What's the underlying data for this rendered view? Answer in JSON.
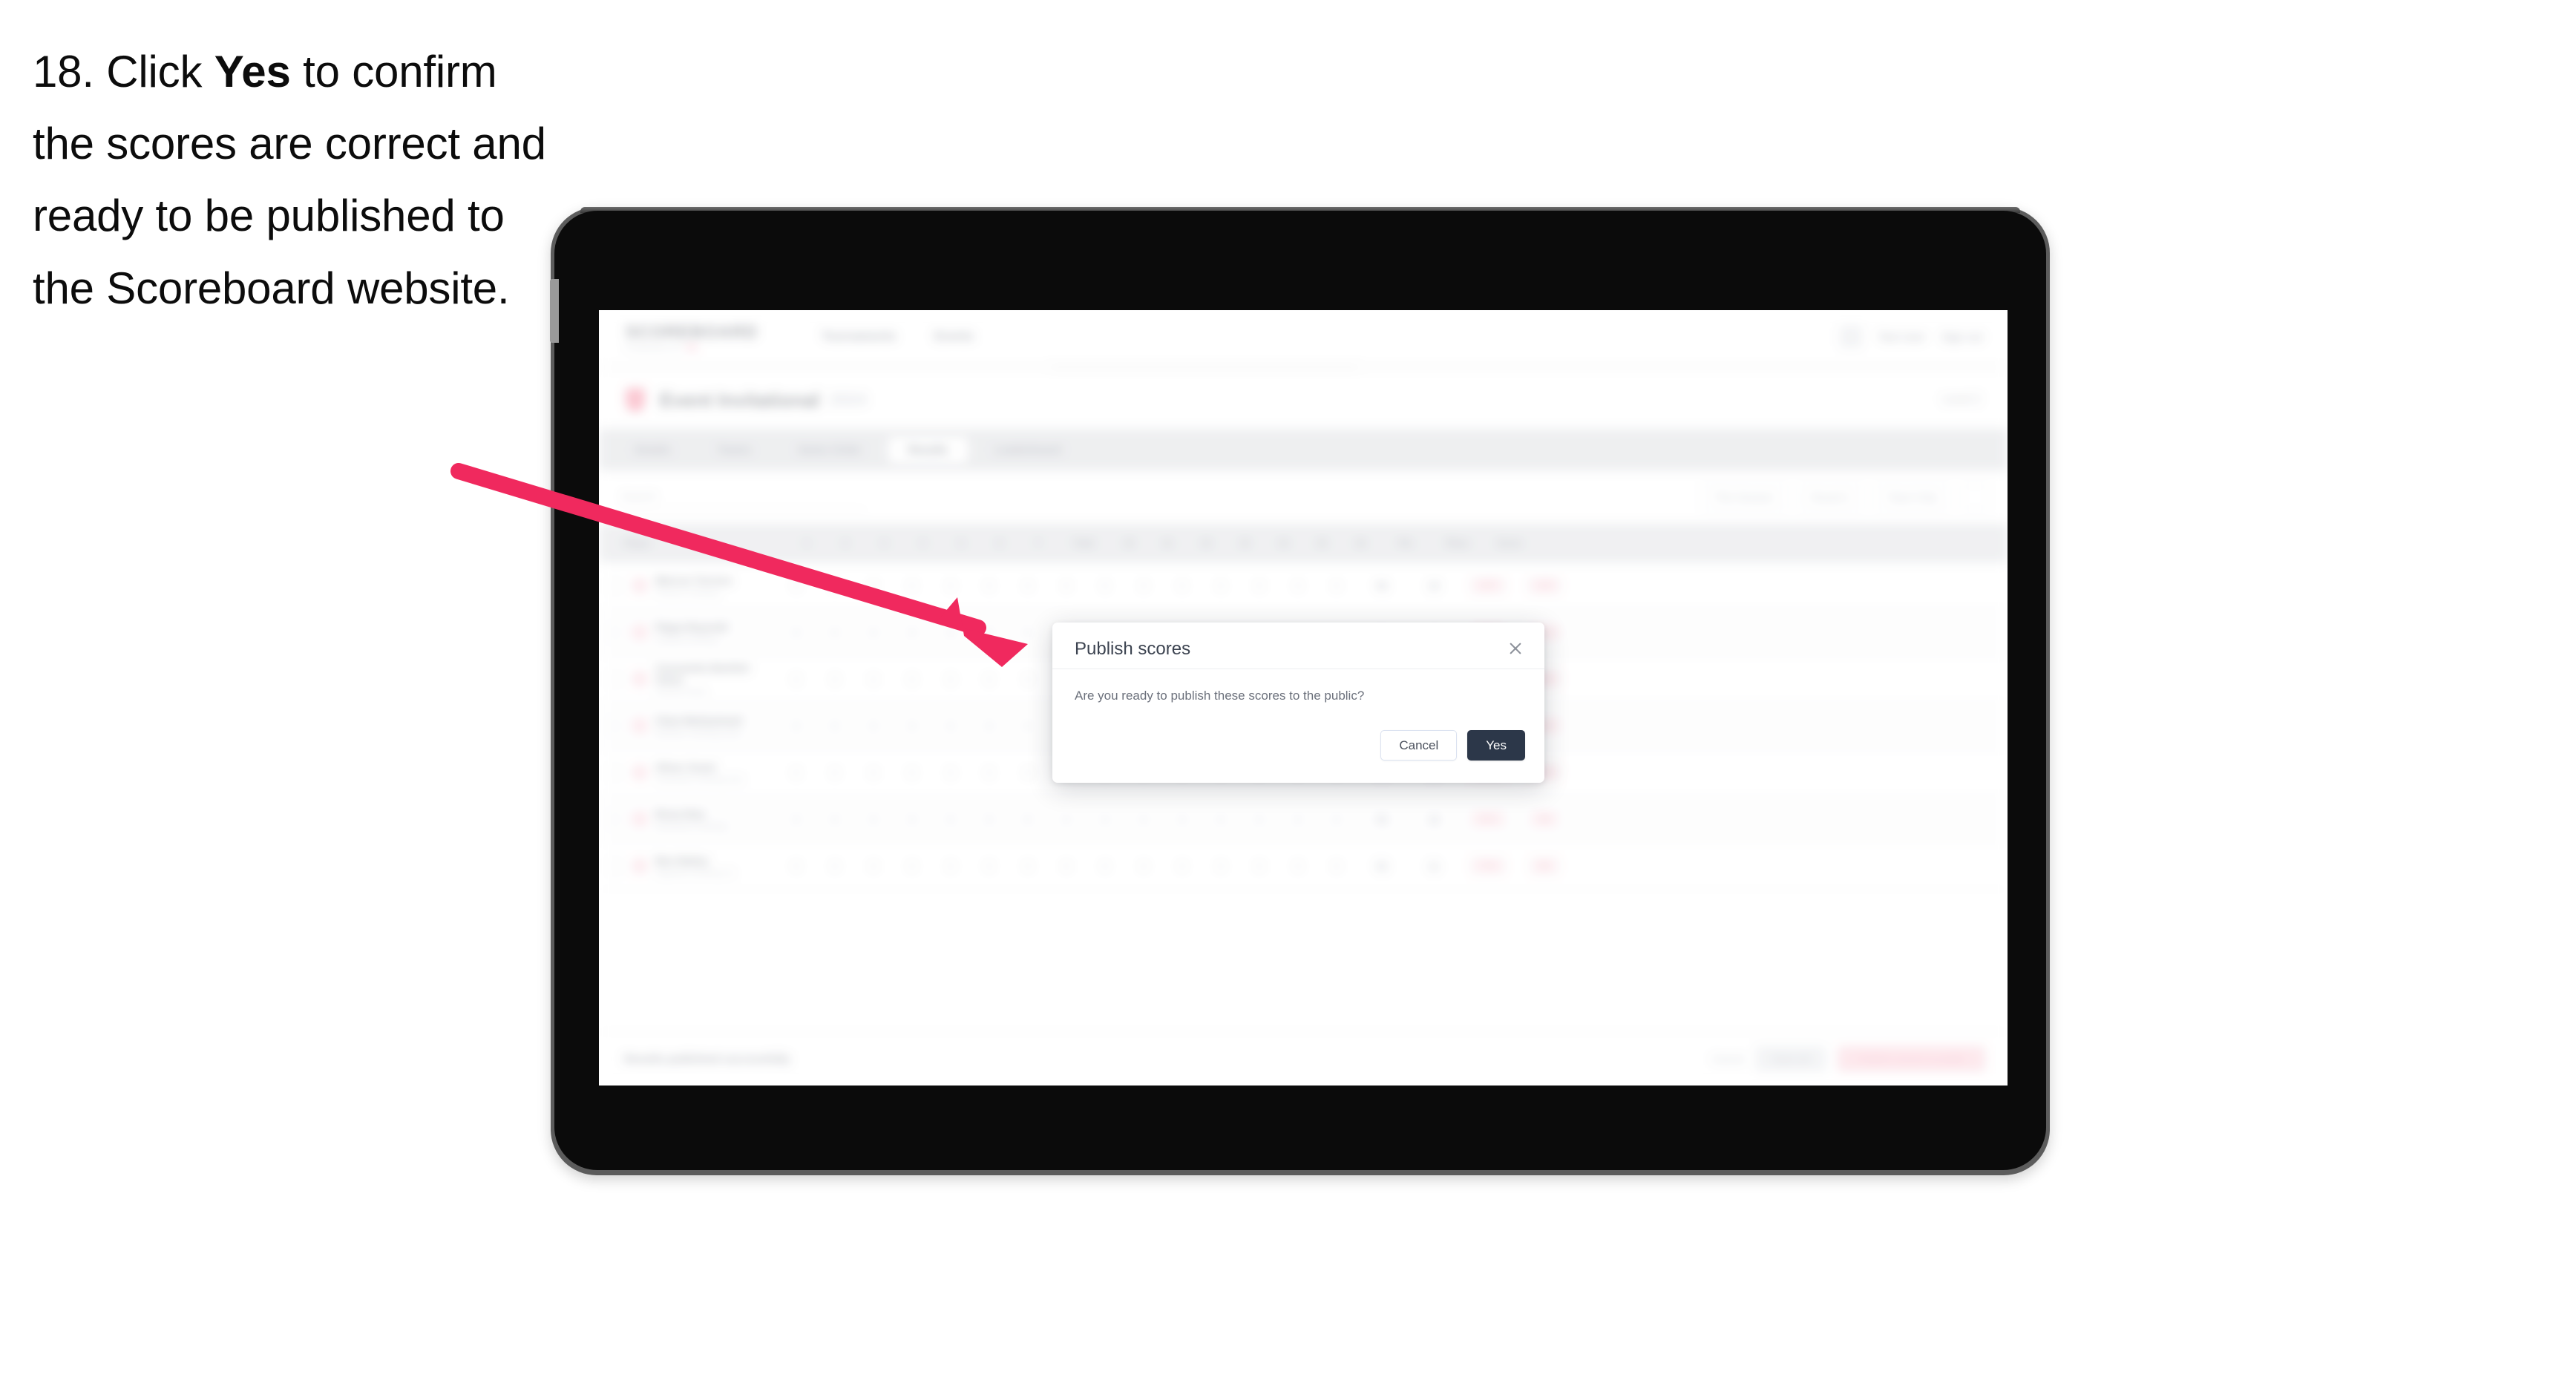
{
  "instruction": {
    "number": "18.",
    "text_before": "Click",
    "emphasis": "Yes",
    "text_after": "to confirm the scores are correct and ready to be published to the Scoreboard website."
  },
  "annotation": {
    "arrow_color": "#f0295e",
    "arrow_name": "pointer-arrow"
  },
  "device": {
    "kind": "tablet",
    "bezel_color": "#0b0b0b",
    "frame_color": "#5c5c5c"
  },
  "app": {
    "logo": {
      "main": "SCOREBOARD",
      "sub": "POWERED BY",
      "sub_accent": "SB"
    },
    "nav_links": [
      "Tournaments",
      "Events"
    ],
    "nav_right": {
      "user": "Test User",
      "signout": "Sign out"
    },
    "title": {
      "badge_color": "#f4607f",
      "text": "Event Invitational",
      "subtext": "2024",
      "right": "Level 2"
    },
    "tabs": [
      {
        "label": "Details",
        "active": false
      },
      {
        "label": "Teams",
        "active": false
      },
      {
        "label": "Game Order",
        "active": false
      },
      {
        "label": "Results",
        "active": true
      },
      {
        "label": "Leaderboard",
        "active": false
      }
    ],
    "filters": {
      "search_placeholder": "Search",
      "buttons": [
        "This Session",
        "Round 1",
        "Team Only"
      ]
    },
    "table": {
      "headers_left": "Player",
      "headers_num": [
        "1",
        "2",
        "3",
        "4",
        "5",
        "6",
        "7",
        "8"
      ],
      "headers_wide": [
        "Total",
        "10",
        "11",
        "12",
        "13",
        "14",
        "15",
        "16"
      ],
      "headers_end": [
        "Pts",
        "Place",
        "Score"
      ],
      "rows": [
        {
          "name": "Marcus Torress",
          "sub": "Phoenix Climbing",
          "nums": [
            "0",
            "0",
            "0",
            "0",
            "0"
          ],
          "total": "56",
          "pts": "15",
          "place": "1ST",
          "score": "125"
        },
        {
          "name": "Pippa Reynold",
          "sub": "Coastal Climbing",
          "nums": [
            "0",
            "0",
            "0",
            "0",
            "0"
          ],
          "total": "56",
          "pts": "15",
          "place": "2ND",
          "score": "122"
        },
        {
          "name": "Cassandra Bartlett-Owen",
          "sub": "Summit Climb",
          "nums": [
            "0",
            "0",
            "0",
            "0",
            "0"
          ],
          "total": "56",
          "pts": "15",
          "place": "3RD",
          "score": "118"
        },
        {
          "name": "Clara Mohammed",
          "sub": "Northern Climbing Club",
          "nums": [
            "0",
            "0",
            "0",
            "0",
            "0",
            "0"
          ],
          "total": "55",
          "pts": "14",
          "place": "4TH",
          "score": "110"
        },
        {
          "name": "Oliver Grant",
          "sub": "Southside Climbing Hub",
          "nums": [
            "0",
            "0",
            "0",
            "0",
            "0",
            "0"
          ],
          "total": "54",
          "pts": "13",
          "place": "5TH",
          "score": "104"
        },
        {
          "name": "Rosa Diaz",
          "sub": "Riverbend Climbing",
          "nums": [
            "0",
            "0",
            "0",
            "0",
            "0",
            "0"
          ],
          "total": "53",
          "pts": "12",
          "place": "6TH",
          "score": "99"
        },
        {
          "name": "Ben Bailey",
          "sub": "Highland Climbing Co",
          "nums": [
            "0",
            "0",
            "0",
            "0",
            "0",
            "0"
          ],
          "total": "52",
          "pts": "11",
          "place": "7TH",
          "score": "95"
        }
      ]
    },
    "footer": {
      "note": "Results published successfully",
      "ghost": "Cancel",
      "grey": "Save all",
      "pink": "Publish scores to public"
    }
  },
  "dialog": {
    "title": "Publish scores",
    "message": "Are you ready to publish these scores to the public?",
    "cancel_label": "Cancel",
    "confirm_label": "Yes",
    "close_icon": "close-icon",
    "confirm_color": "#2c3749"
  }
}
